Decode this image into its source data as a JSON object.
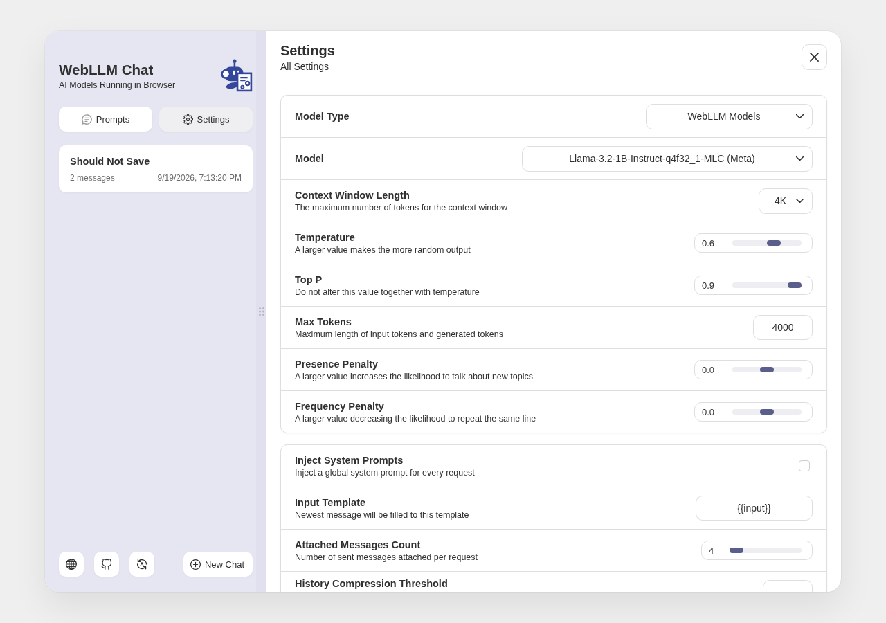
{
  "sidebar": {
    "title": "WebLLM Chat",
    "subtitle": "AI Models Running in Browser",
    "nav_buttons": [
      {
        "label": "Prompts",
        "selected": false
      },
      {
        "label": "Settings",
        "selected": true
      }
    ],
    "chats": [
      {
        "title": "Should Not Save",
        "count": "2 messages",
        "time": "9/19/2026, 7:13:20 PM"
      }
    ],
    "new_chat_button": "New Chat"
  },
  "settings": {
    "title": "Settings",
    "subtitle": "All Settings",
    "groups": [
      {
        "rows": [
          {
            "kind": "select",
            "label": "Model Type",
            "value": "WebLLM Models"
          },
          {
            "kind": "select",
            "label": "Model",
            "value": "Llama-3.2-1B-Instruct-q4f32_1-MLC (Meta)"
          },
          {
            "kind": "select",
            "label": "Context Window Length",
            "description": "The maximum number of tokens for the context window",
            "value": "4K"
          },
          {
            "kind": "slider",
            "label": "Temperature",
            "description": "A larger value makes the more random output",
            "value": "0.6",
            "level": 0.6
          },
          {
            "kind": "slider",
            "label": "Top P",
            "description": "Do not alter this value together with temperature",
            "value": "0.9",
            "level": 0.9
          },
          {
            "kind": "number",
            "label": "Max Tokens",
            "description": "Maximum length of input tokens and generated tokens",
            "value": "4000"
          },
          {
            "kind": "slider",
            "label": "Presence Penalty",
            "description": "A larger value increases the likelihood to talk about new topics",
            "value": "0.0",
            "level": 0.5
          },
          {
            "kind": "slider",
            "label": "Frequency Penalty",
            "description": "A larger value decreasing the likelihood to repeat the same line",
            "value": "0.0",
            "level": 0.5
          }
        ]
      },
      {
        "rows": [
          {
            "kind": "checkbox",
            "label": "Inject System Prompts",
            "description": "Inject a global system prompt for every request",
            "checked": false
          },
          {
            "kind": "text",
            "label": "Input Template",
            "description": "Newest message will be filled to this template",
            "value": "{{input}}"
          },
          {
            "kind": "slider",
            "label": "Attached Messages Count",
            "description": "Number of sent messages attached per request",
            "value": "4",
            "level": 0.0625
          },
          {
            "kind": "number",
            "label": "History Compression Threshold"
          }
        ]
      }
    ]
  }
}
